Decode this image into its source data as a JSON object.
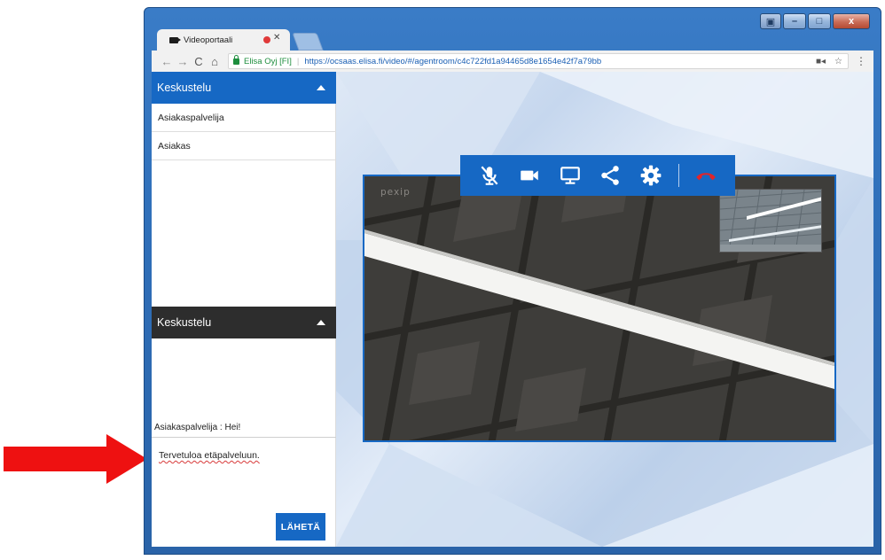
{
  "colors": {
    "accent": "#1668c4",
    "dark_header": "#2d2d2d",
    "hangup": "#e0252b",
    "annotation_arrow": "#ee1111"
  },
  "browser": {
    "tab_title": "Videoportaali",
    "site_name": "Elisa Oyj [FI]",
    "url": "https://ocsaas.elisa.fi/video/#/agentroom/c4c722fd1a94465d8e1654e42f7a79bb",
    "nav_icons": [
      "back-icon",
      "forward-icon",
      "reload-icon",
      "home-icon"
    ],
    "window_buttons": [
      "minimize",
      "maximize",
      "close"
    ]
  },
  "sidebar": {
    "participants_header": "Keskustelu",
    "participants": [
      "Asiakaspalvelija",
      "Asiakas"
    ],
    "chat_header": "Keskustelu",
    "messages": [
      {
        "text": "Asiakaspalvelija : Hei!"
      }
    ],
    "input_value": "Tervetuloa etäpalveluun.",
    "send_label": "LÄHETÄ"
  },
  "video": {
    "watermark": "pexip",
    "controls": [
      "microphone-muted-icon",
      "camera-icon",
      "screen-share-icon",
      "share-icon",
      "settings-icon",
      "hang-up-icon"
    ]
  },
  "annotation": {
    "icon": "red-arrow-icon"
  }
}
